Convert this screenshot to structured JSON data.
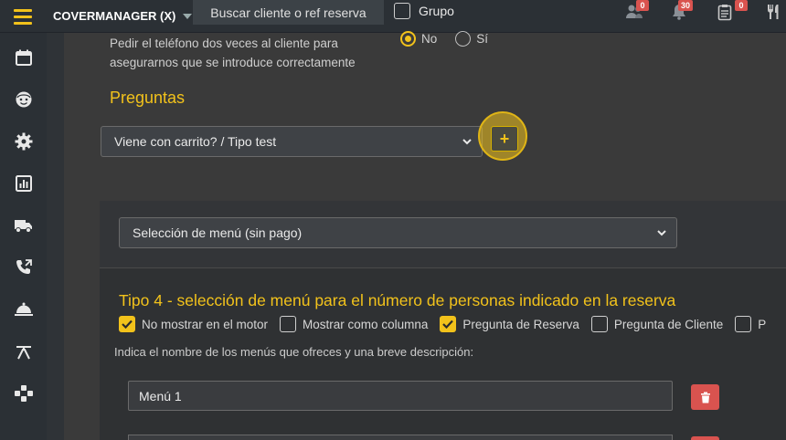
{
  "topbar": {
    "brand": "COVERMANAGER (X)",
    "search_label": "Buscar cliente o ref reserva",
    "grupo_label": "Grupo",
    "badges": {
      "clients": "0",
      "notifications": "30",
      "reports": "0"
    }
  },
  "sidebar": {
    "items": [
      {
        "icon": "calendar-icon"
      },
      {
        "icon": "face-icon"
      },
      {
        "icon": "gear-icon"
      },
      {
        "icon": "chart-icon"
      },
      {
        "icon": "truck-icon"
      },
      {
        "icon": "phone-icon"
      },
      {
        "icon": "cloche-icon"
      },
      {
        "icon": "table-icon"
      },
      {
        "icon": "gamepad-icon"
      }
    ]
  },
  "phone_setting": {
    "text": "Pedir el teléfono dos veces al cliente para asegurarnos que se introduce correctamente",
    "option_no": "No",
    "option_si": "Sí",
    "selected": "No"
  },
  "preguntas": {
    "heading": "Preguntas",
    "select_value": "Viene con carrito? / Tipo test",
    "add_label": "+"
  },
  "card": {
    "menu_select_value": "Selección de menú (sin pago)",
    "tipo_title": "Tipo 4 - selección de menú para el número de personas indicado en la reserva",
    "options": [
      {
        "label": "No mostrar en el motor",
        "checked": true
      },
      {
        "label": "Mostrar como columna",
        "checked": false
      },
      {
        "label": "Pregunta de Reserva",
        "checked": true
      },
      {
        "label": "Pregunta de Cliente",
        "checked": false
      },
      {
        "label": "P",
        "checked": false
      }
    ],
    "hint": "Indica el nombre de los menús que ofreces y una breve descripción:",
    "menu1_value": "Menú 1"
  },
  "colors": {
    "accent": "#f2c21b",
    "danger": "#d9534f",
    "sidebar": "#2b3035"
  }
}
